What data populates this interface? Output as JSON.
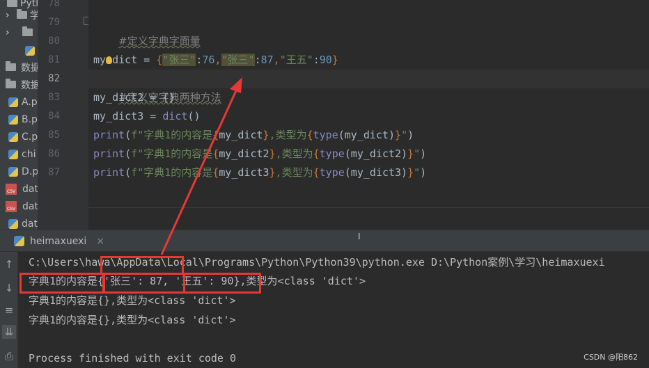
{
  "sidebar": {
    "items": [
      {
        "label": "Pytho",
        "icon": "folder-icon"
      },
      {
        "label": "学习",
        "icon": "folder-icon"
      },
      {
        "label": "",
        "icon": "folder-icon"
      },
      {
        "label": "",
        "icon": "python-file-icon"
      },
      {
        "label": "数据",
        "icon": "folder-icon"
      },
      {
        "label": "数据",
        "icon": "folder-icon"
      },
      {
        "label": "A.p",
        "icon": "python-file-icon"
      },
      {
        "label": "B.p",
        "icon": "python-file-icon"
      },
      {
        "label": "C.p",
        "icon": "python-file-icon"
      },
      {
        "label": "chi",
        "icon": "python-file-icon"
      },
      {
        "label": "D.p",
        "icon": "python-file-icon"
      },
      {
        "label": "dat",
        "icon": "csv-file-icon"
      },
      {
        "label": "dat",
        "icon": "csv-file-icon"
      },
      {
        "label": "dat",
        "icon": "python-file-icon"
      }
    ],
    "csv_badge": "CSV"
  },
  "editor": {
    "line_numbers": [
      "78",
      "79",
      "80",
      "81",
      "82",
      "83",
      "84",
      "85",
      "86",
      "87"
    ],
    "current_line": "82",
    "l79_comment": "#定义字典字面量",
    "l81": {
      "var_a": "my",
      "var_b": "dict",
      "op": " = ",
      "open": "{",
      "k1": "\"张三\"",
      "c1": ":",
      "v1": "76",
      "sep1": ",",
      "k2": "\"张三\"",
      "c2": ":",
      "v2": "87",
      "sep2": ",",
      "k3": "\"王五\"",
      "c3": ":",
      "v3": "90",
      "close": "}"
    },
    "l82_comment": "#定义空字典两种方法",
    "l83": "my_dict2 = {}",
    "l84": {
      "lhs": "my_dict3 = ",
      "fn": "dict",
      "args": "()"
    },
    "l85": {
      "fn": "print",
      "open": "(",
      "pre": "f\"字典1的内容是",
      "b1": "{",
      "e1": "my_dict",
      "b2": "}",
      "mid": ",类型为",
      "b3": "{",
      "tfn": "type",
      "e2": "(my_dict)",
      "b4": "}",
      "end": "\"",
      "close": ")"
    },
    "l86": {
      "fn": "print",
      "open": "(",
      "pre": "f\"字典1的内容是",
      "b1": "{",
      "e1": "my_dict2",
      "b2": "}",
      "mid": ",类型为",
      "b3": "{",
      "tfn": "type",
      "e2": "(my_dict2)",
      "b4": "}",
      "end": "\"",
      "close": ")"
    },
    "l87": {
      "fn": "print",
      "open": "(",
      "pre": "f\"字典1的内容是",
      "b1": "{",
      "e1": "my_dict3",
      "b2": "}",
      "mid": ",类型为",
      "b3": "{",
      "tfn": "type",
      "e2": "(my_dict3)",
      "b4": "}",
      "end": "\"",
      "close": ")"
    }
  },
  "run_panel": {
    "tab_label": "heimaxuexi",
    "close_label": "×",
    "cursor_char": "I",
    "toolbar_icons": [
      "rerun-icon",
      "down-arrow-icon",
      "soft-wrap-icon",
      "scroll-to-end-icon",
      "print-icon"
    ],
    "toolbar_glyphs": [
      "↑",
      "↓",
      "≡",
      "⇊",
      "⎙"
    ],
    "console_lines": [
      "C:\\Users\\hawa\\AppData\\Local\\Programs\\Python\\Python39\\python.exe D:\\Python案例\\学习\\heimaxuexi",
      "字典1的内容是{'张三': 87, '王五': 90},类型为<class 'dict'>",
      "字典1的内容是{},类型为<class 'dict'>",
      "字典1的内容是{},类型为<class 'dict'>",
      "",
      "Process finished with exit code 0"
    ]
  },
  "colors": {
    "annotation_red": "#e53935",
    "editor_bg": "#2b2b2b",
    "string_green": "#6a8759",
    "number_blue": "#6897bb"
  },
  "watermark": "CSDN @阳862"
}
